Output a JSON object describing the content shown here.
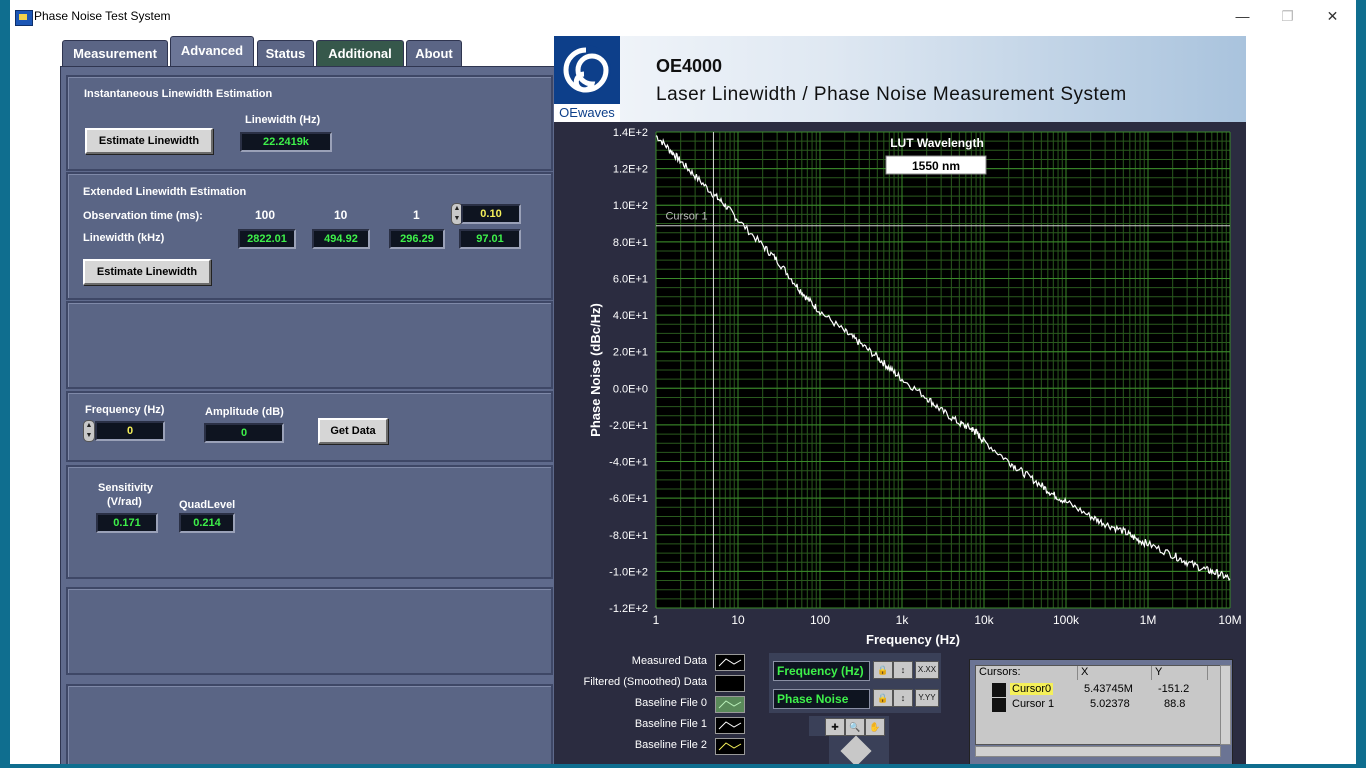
{
  "window": {
    "title": "Phase Noise Test System"
  },
  "tabs": [
    {
      "label": "Measurement",
      "active": false
    },
    {
      "label": "Advanced",
      "active": true
    },
    {
      "label": "Status",
      "active": false
    },
    {
      "label": "Additional",
      "active": false
    },
    {
      "label": "About",
      "active": false
    }
  ],
  "instantaneous": {
    "title": "Instantaneous Linewidth Estimation",
    "button": "Estimate Linewidth",
    "linewidth_label": "Linewidth (Hz)",
    "linewidth_value": "22.2419k"
  },
  "extended": {
    "title": "Extended Linewidth Estimation",
    "obs_label": "Observation time (ms):",
    "linewidth_label": "Linewidth (kHz)",
    "obs_times": [
      "100",
      "10",
      "1",
      "0.10"
    ],
    "linewidths": [
      "2822.01",
      "494.92",
      "296.29",
      "97.01"
    ],
    "button": "Estimate Linewidth"
  },
  "getdata": {
    "freq_label": "Frequency (Hz)",
    "freq_value": "0",
    "amp_label": "Amplitude (dB)",
    "amp_value": "0",
    "button": "Get Data"
  },
  "sensitivity": {
    "sens_label_line1": "Sensitivity",
    "sens_label_line2": "(V/rad)",
    "sens_value": "0.171",
    "quad_label": "QuadLevel",
    "quad_value": "0.214"
  },
  "banner": {
    "logo_text": "OEwaves",
    "title": "OE4000",
    "subtitle": "Laser Linewidth / Phase Noise Measurement System"
  },
  "lut": {
    "label": "LUT Wavelength",
    "value": "1550 nm"
  },
  "chart_data": {
    "type": "line",
    "xlabel": "Frequency (Hz)",
    "ylabel": "Phase Noise (dBc/Hz)",
    "x_scale": "log",
    "xlim": [
      1,
      10000000
    ],
    "ylim": [
      -120,
      140
    ],
    "x_ticks": [
      "1",
      "10",
      "100",
      "1k",
      "10k",
      "100k",
      "1M",
      "10M"
    ],
    "y_ticks": [
      "1.4E+2",
      "1.2E+2",
      "1.0E+2",
      "8.0E+1",
      "6.0E+1",
      "4.0E+1",
      "2.0E+1",
      "0.0E+0",
      "-2.0E+1",
      "-4.0E+1",
      "-6.0E+1",
      "-8.0E+1",
      "-1.0E+2",
      "-1.2E+2"
    ],
    "grid": true,
    "colors": {
      "background": "#000000",
      "grid_major": "#3a8a2a",
      "grid_minor": "#2a5a1e",
      "trace": "#ffffff",
      "cursor": "#d0d0d0"
    },
    "series": [
      {
        "x": [
          1,
          1.5,
          2,
          3,
          5,
          7,
          10,
          20,
          30,
          50,
          70,
          100,
          200,
          300,
          500,
          700,
          1000,
          2000,
          3000,
          5000,
          7000,
          8000,
          10000,
          20000,
          30000,
          50000,
          70000,
          100000,
          200000,
          300000,
          500000,
          700000,
          1000000,
          2000000,
          3000000,
          5000000,
          7000000,
          10000000
        ],
        "y": [
          138,
          130,
          124,
          116,
          106,
          100,
          92,
          78,
          70,
          57,
          49,
          42,
          31,
          25,
          17,
          11,
          5,
          -5,
          -12,
          -19,
          -22,
          -24,
          -29,
          -40,
          -46,
          -53,
          -58,
          -62,
          -70,
          -74,
          -78,
          -82,
          -85,
          -91,
          -95,
          -99,
          -101,
          -104
        ]
      }
    ],
    "cursors": [
      {
        "name": "Cursor 1",
        "x": 5.02378,
        "y": 88.8
      }
    ]
  },
  "legend": [
    {
      "label": "Measured  Data"
    },
    {
      "label": "Filtered (Smoothed) Data"
    },
    {
      "label": "Baseline File 0"
    },
    {
      "label": "Baseline File 1"
    },
    {
      "label": "Baseline File 2"
    }
  ],
  "scale_legend": {
    "x_name": "Frequency (Hz)",
    "y_name": "Phase Noise",
    "x_fmt": "X.XX",
    "y_fmt": "Y.YY"
  },
  "cursor_table": {
    "headers": [
      "Cursors:",
      "X",
      "Y"
    ],
    "rows": [
      {
        "name": "Cursor0",
        "x": "5.43745M",
        "y": "-151.2"
      },
      {
        "name": "Cursor 1",
        "x": "5.02378",
        "y": "88.8"
      }
    ]
  }
}
